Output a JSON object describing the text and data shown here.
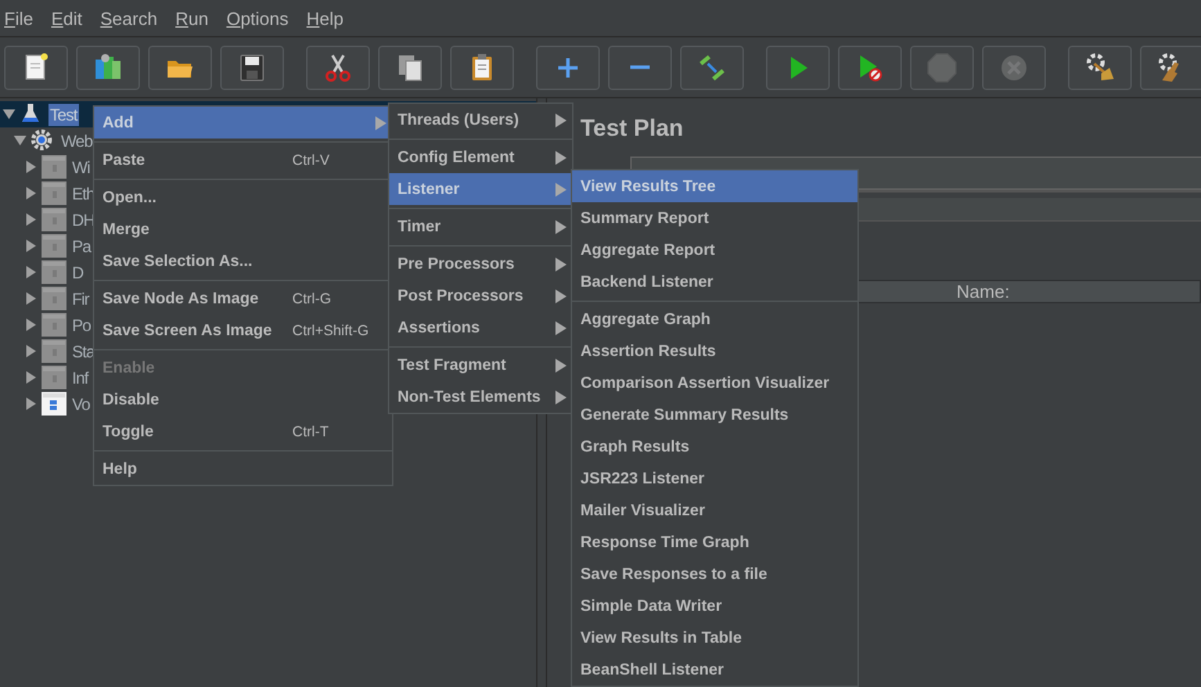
{
  "menu_bar": [
    {
      "label": "File"
    },
    {
      "label": "Edit"
    },
    {
      "label": "Search"
    },
    {
      "label": "Run"
    },
    {
      "label": "Options"
    },
    {
      "label": "Help"
    }
  ],
  "toolbar": [
    {
      "buttons": [
        {
          "kind": "new",
          "disabled": false
        },
        {
          "kind": "templates",
          "disabled": false
        },
        {
          "kind": "open",
          "disabled": false
        },
        {
          "kind": "save",
          "disabled": false
        }
      ]
    },
    {
      "buttons": [
        {
          "kind": "cut",
          "disabled": false
        },
        {
          "kind": "copy",
          "disabled": false
        },
        {
          "kind": "paste",
          "disabled": false
        }
      ]
    },
    {
      "buttons": [
        {
          "kind": "expand",
          "disabled": false
        },
        {
          "kind": "collapse",
          "disabled": false
        },
        {
          "kind": "toggle",
          "disabled": false
        }
      ]
    },
    {
      "buttons": [
        {
          "kind": "start",
          "disabled": false
        },
        {
          "kind": "start_no_pauses",
          "disabled": false
        },
        {
          "kind": "stop",
          "disabled": true
        },
        {
          "kind": "shutdown",
          "disabled": true
        }
      ]
    },
    {
      "buttons": [
        {
          "kind": "clear",
          "disabled": false
        },
        {
          "kind": "clear_all",
          "disabled": false
        }
      ]
    }
  ],
  "tree": [
    {
      "label": "Test",
      "kind": "plan",
      "selected": true,
      "expanded": true,
      "disabled": false,
      "children": [
        {
          "label": "Web",
          "kind": "gear",
          "selected": false,
          "expanded": true,
          "disabled": false,
          "children": [
            {
              "label": "Wi",
              "kind": "element",
              "selected": false,
              "expanded": false,
              "disabled": true
            },
            {
              "label": "Eth",
              "kind": "element",
              "selected": false,
              "expanded": false,
              "disabled": true
            },
            {
              "label": "DH",
              "kind": "element",
              "selected": false,
              "expanded": false,
              "disabled": true
            },
            {
              "label": "Pa",
              "kind": "element",
              "selected": false,
              "expanded": false,
              "disabled": true
            },
            {
              "label": "D",
              "kind": "element",
              "selected": false,
              "expanded": false,
              "disabled": true
            },
            {
              "label": "Fir",
              "kind": "element",
              "selected": false,
              "expanded": false,
              "disabled": true
            },
            {
              "label": "Po",
              "kind": "element",
              "selected": false,
              "expanded": false,
              "disabled": true
            },
            {
              "label": "Sta",
              "kind": "element",
              "selected": false,
              "expanded": false,
              "disabled": true
            },
            {
              "label": "Inf",
              "kind": "element",
              "selected": false,
              "expanded": false,
              "disabled": true
            },
            {
              "label": "Vo",
              "kind": "element",
              "selected": false,
              "expanded": false,
              "disabled": false
            }
          ]
        }
      ]
    }
  ],
  "panel": {
    "title": "Test Plan",
    "table": {
      "columns": [
        "Name:"
      ]
    }
  },
  "context_menu": {
    "items": [
      {
        "kind": "item",
        "label": "Add",
        "submenu": true,
        "selected": true,
        "disabled": false
      },
      {
        "kind": "separator"
      },
      {
        "kind": "item",
        "label": "Paste",
        "shortcut": "Ctrl-V",
        "submenu": false,
        "selected": false,
        "disabled": false
      },
      {
        "kind": "separator"
      },
      {
        "kind": "item",
        "label": "Open...",
        "submenu": false,
        "selected": false,
        "disabled": false
      },
      {
        "kind": "item",
        "label": "Merge",
        "submenu": false,
        "selected": false,
        "disabled": false
      },
      {
        "kind": "item",
        "label": "Save Selection As...",
        "submenu": false,
        "selected": false,
        "disabled": false
      },
      {
        "kind": "separator"
      },
      {
        "kind": "item",
        "label": "Save Node As Image",
        "shortcut": "Ctrl-G",
        "submenu": false,
        "selected": false,
        "disabled": false
      },
      {
        "kind": "item",
        "label": "Save Screen As Image",
        "shortcut": "Ctrl+Shift-G",
        "submenu": false,
        "selected": false,
        "disabled": false
      },
      {
        "kind": "separator"
      },
      {
        "kind": "item",
        "label": "Enable",
        "submenu": false,
        "selected": false,
        "disabled": true
      },
      {
        "kind": "item",
        "label": "Disable",
        "submenu": false,
        "selected": false,
        "disabled": false
      },
      {
        "kind": "item",
        "label": "Toggle",
        "shortcut": "Ctrl-T",
        "submenu": false,
        "selected": false,
        "disabled": false
      },
      {
        "kind": "separator"
      },
      {
        "kind": "item",
        "label": "Help",
        "submenu": false,
        "selected": false,
        "disabled": false
      }
    ]
  },
  "add_submenu": {
    "items": [
      {
        "kind": "item",
        "label": "Threads (Users)",
        "submenu": true,
        "selected": false
      },
      {
        "kind": "separator"
      },
      {
        "kind": "item",
        "label": "Config Element",
        "submenu": true,
        "selected": false
      },
      {
        "kind": "item",
        "label": "Listener",
        "submenu": true,
        "selected": true
      },
      {
        "kind": "separator"
      },
      {
        "kind": "item",
        "label": "Timer",
        "submenu": true,
        "selected": false
      },
      {
        "kind": "separator"
      },
      {
        "kind": "item",
        "label": "Pre Processors",
        "submenu": true,
        "selected": false
      },
      {
        "kind": "item",
        "label": "Post Processors",
        "submenu": true,
        "selected": false
      },
      {
        "kind": "item",
        "label": "Assertions",
        "submenu": true,
        "selected": false
      },
      {
        "kind": "separator"
      },
      {
        "kind": "item",
        "label": "Test Fragment",
        "submenu": true,
        "selected": false
      },
      {
        "kind": "item",
        "label": "Non-Test Elements",
        "submenu": true,
        "selected": false
      }
    ]
  },
  "listener_submenu": {
    "items": [
      {
        "kind": "item",
        "label": "View Results Tree",
        "selected": true
      },
      {
        "kind": "item",
        "label": "Summary Report",
        "selected": false
      },
      {
        "kind": "item",
        "label": "Aggregate Report",
        "selected": false
      },
      {
        "kind": "item",
        "label": "Backend Listener",
        "selected": false
      },
      {
        "kind": "separator"
      },
      {
        "kind": "item",
        "label": "Aggregate Graph",
        "selected": false
      },
      {
        "kind": "item",
        "label": "Assertion Results",
        "selected": false
      },
      {
        "kind": "item",
        "label": "Comparison Assertion Visualizer",
        "selected": false
      },
      {
        "kind": "item",
        "label": "Generate Summary Results",
        "selected": false
      },
      {
        "kind": "item",
        "label": "Graph Results",
        "selected": false
      },
      {
        "kind": "item",
        "label": "JSR223 Listener",
        "selected": false
      },
      {
        "kind": "item",
        "label": "Mailer Visualizer",
        "selected": false
      },
      {
        "kind": "item",
        "label": "Response Time Graph",
        "selected": false
      },
      {
        "kind": "item",
        "label": "Save Responses to a file",
        "selected": false
      },
      {
        "kind": "item",
        "label": "Simple Data Writer",
        "selected": false
      },
      {
        "kind": "item",
        "label": "View Results in Table",
        "selected": false
      },
      {
        "kind": "item",
        "label": "BeanShell Listener",
        "selected": false
      }
    ]
  }
}
